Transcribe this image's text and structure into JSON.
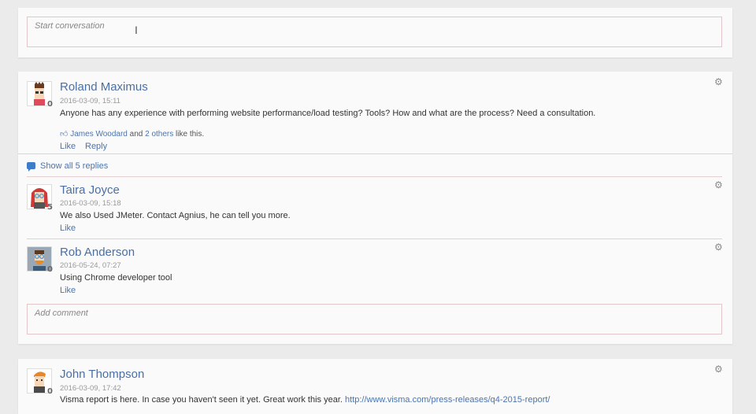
{
  "compose": {
    "placeholder": "Start conversation"
  },
  "posts": [
    {
      "author": "Roland Maximus",
      "date": "2016-03-09, 15:11",
      "avatar_count": "0",
      "text": "Anyone has any experience with performing website performance/load testing? Tools? How and what are the process? Need a consultation.",
      "likes": {
        "person": "James Woodard",
        "and": "and",
        "others": "2 others",
        "suffix": "like this."
      },
      "like_label": "Like",
      "reply_label": "Reply",
      "show_replies": "Show all 5 replies",
      "replies": [
        {
          "author": "Taira Joyce",
          "date": "2016-03-09, 15:18",
          "avatar_count": "5",
          "text": "We also Used JMeter. Contact Agnius, he can tell you more.",
          "like_label": "Like"
        },
        {
          "author": "Rob Anderson",
          "date": "2016-05-24, 07:27",
          "avatar_count": "0",
          "text": "Using Chrome developer tool",
          "like_label": "Like"
        }
      ],
      "comment_placeholder": "Add comment"
    },
    {
      "author": "John Thompson",
      "date": "2016-03-09, 17:42",
      "avatar_count": "0",
      "text_prefix": "Visma report is here. In case you haven't seen it yet. Great work this year.",
      "text_link": "http://www.visma.com/press-releases/q4-2015-report/"
    }
  ],
  "icons": {
    "gear": "gear-icon",
    "thumbs_up": "thumbs-up-icon",
    "comments": "comments-icon"
  },
  "colors": {
    "accent": "#4a74b0",
    "divider": "#e6cfd1",
    "background": "#ebebeb"
  }
}
